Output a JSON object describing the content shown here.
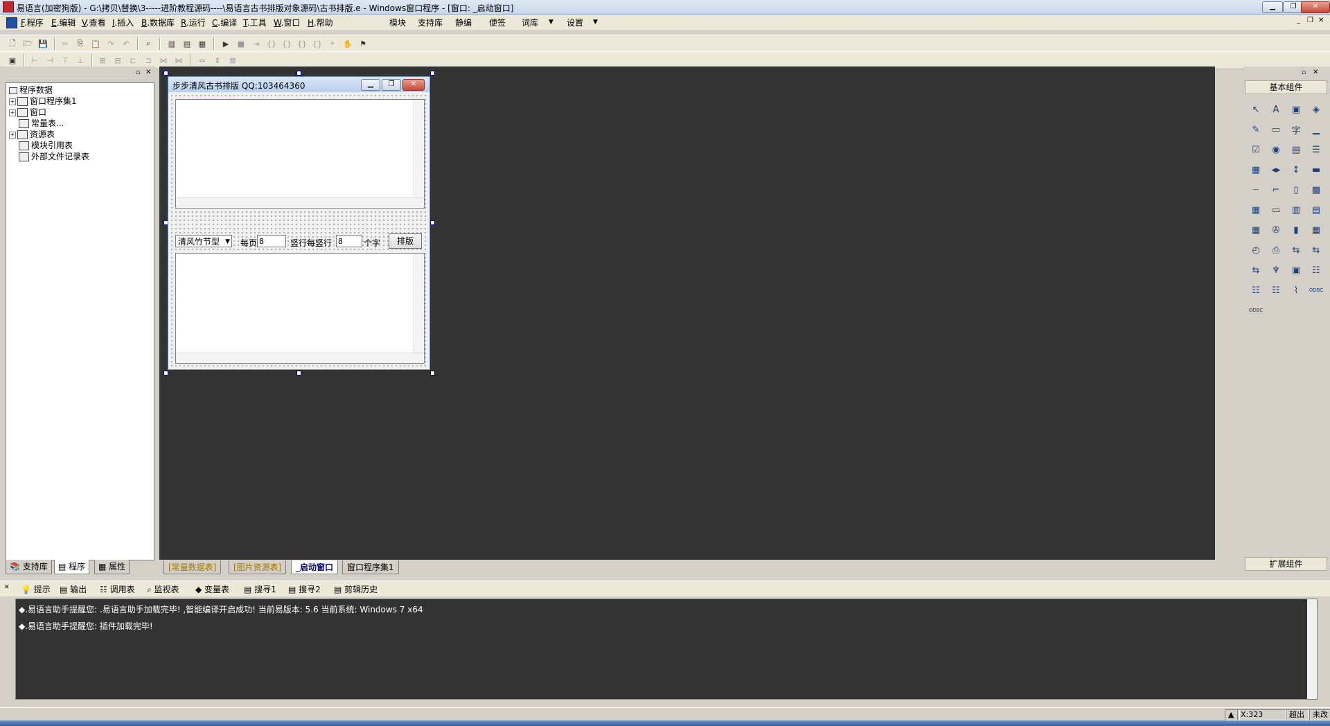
{
  "window": {
    "title": "易语言(加密狗版) - G:\\拷贝\\替换\\3-----进阶教程源码----\\易语言古书排版对象源码\\古书排版.e - Windows窗口程序 - [窗口: _启动窗口]",
    "min_glyph": "▁",
    "max_glyph": "❐",
    "close_glyph": "✕"
  },
  "menu": {
    "items": [
      {
        "key": "F",
        "label": ".程序"
      },
      {
        "key": "E",
        "label": ".编辑"
      },
      {
        "key": "V",
        "label": ".查看"
      },
      {
        "key": "I",
        "label": ".插入"
      },
      {
        "key": "B",
        "label": ".数据库"
      },
      {
        "key": "R",
        "label": ".运行"
      },
      {
        "key": "C",
        "label": ".编译"
      },
      {
        "key": "T",
        "label": ".工具"
      },
      {
        "key": "W",
        "label": ".窗口"
      },
      {
        "key": "H",
        "label": ".帮助"
      }
    ],
    "extra": [
      "模块",
      "支持库",
      "静编",
      "便签",
      "词库",
      "设置"
    ],
    "dropdown_glyph": "▼",
    "mdi_controls": [
      "_",
      "❐",
      "✕"
    ]
  },
  "left_panel": {
    "tree": {
      "root": "程序数据",
      "children": [
        {
          "label": "窗口程序集1",
          "expander": "+"
        },
        {
          "label": "窗口",
          "expander": "+"
        },
        {
          "label": "常量表...",
          "expander": ""
        },
        {
          "label": "资源表",
          "expander": "+"
        },
        {
          "label": "模块引用表",
          "expander": ""
        },
        {
          "label": "外部文件记录表",
          "expander": ""
        }
      ]
    },
    "tabs": [
      "支持库",
      "程序",
      "属性"
    ]
  },
  "form": {
    "title": "步步清风古书排版 QQ:103464360",
    "combo_value": "清风竹节型",
    "label_per_page": "每页",
    "per_page_value": "8",
    "label_per_column": "竖行每竖行",
    "per_column_value": "8",
    "label_chars": "个字",
    "layout_button": "排版"
  },
  "doc_tabs": {
    "items": [
      "[常量数据表]",
      "[图片资源表]",
      "_启动窗口",
      "窗口程序集1"
    ],
    "colors": [
      "#a07800",
      "#a07800",
      "#000080",
      "#000000"
    ]
  },
  "right_panel": {
    "basic_title": "基本组件",
    "ext_title": "扩展组件",
    "components": [
      "↖",
      "A",
      "▣",
      "◈",
      "✎",
      "▭",
      "字",
      "▁",
      "☑",
      "◉",
      "▤",
      "☰",
      "▦",
      "◂▸",
      "↕",
      "▬",
      "┈",
      "⌐",
      "▯",
      "▩",
      "▦",
      "▭",
      "▥",
      "▤",
      "▦",
      "✇",
      "▮",
      "▦",
      "◴",
      "⎙",
      "⇆",
      "⇆",
      "⇆",
      "♆",
      "▣",
      "☷",
      "☷",
      "☷",
      "⌇",
      "ODBC",
      "ODBC"
    ]
  },
  "output_tabs": [
    "提示",
    "输出",
    "调用表",
    "监视表",
    "变量表",
    "搜寻1",
    "搜寻2",
    "剪辑历史"
  ],
  "output_lines": [
    "◆.易语言助手提醒您: .易语言助手加载完毕!  ,智能编译开启成功!  当前易版本: 5.6  当前系统: Windows 7 x64",
    "◆.易语言助手提醒您: 插件加载完毕!"
  ],
  "status": {
    "coords": "X:323",
    "mode": "超出",
    "state": "未改"
  }
}
